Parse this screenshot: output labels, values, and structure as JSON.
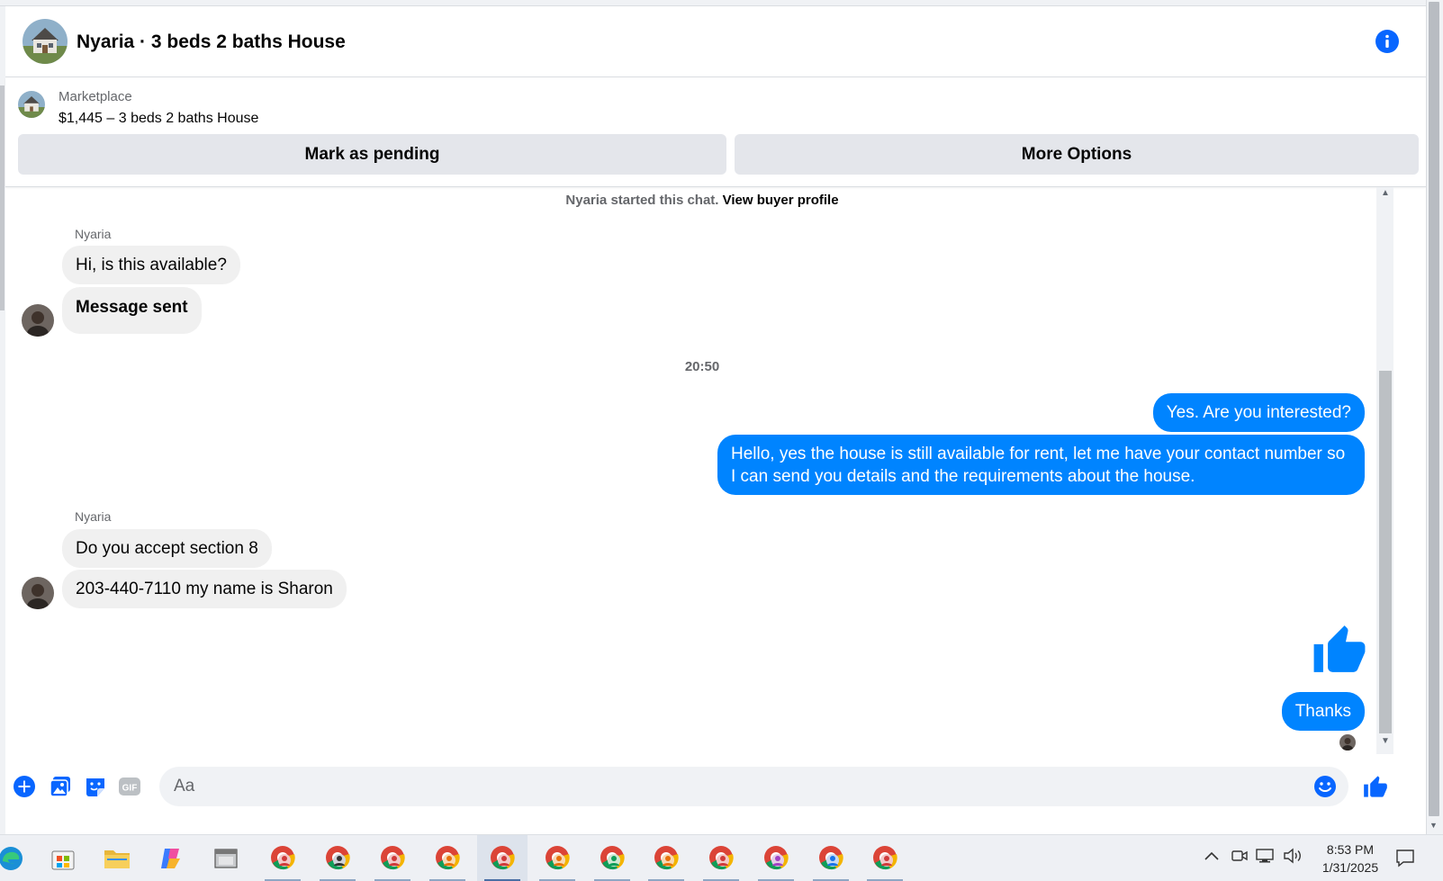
{
  "header": {
    "title": "Nyaria · 3 beds 2 baths House",
    "info_icon": "info-icon"
  },
  "listing": {
    "source": "Marketplace",
    "price_title": "$1,445 – 3 beds 2 baths House",
    "buttons": {
      "pending": "Mark as pending",
      "more": "More Options"
    }
  },
  "chat": {
    "started_text": "Nyaria started this chat.",
    "view_profile": "View buyer profile",
    "sender_name": "Nyaria",
    "timestamp": "20:50",
    "messages": [
      {
        "from": "buyer",
        "text": "Hi, is this available?"
      },
      {
        "from": "buyer",
        "text": "Message sent"
      },
      {
        "from": "seller",
        "text": "Yes. Are you interested?"
      },
      {
        "from": "seller",
        "text": "Hello, yes the house is still available for rent, let me have your contact number so I can send you details and the requirements about the house."
      },
      {
        "from": "buyer",
        "text": "Do you accept section 8"
      },
      {
        "from": "buyer",
        "text": "203-440-7110 my name is Sharon"
      },
      {
        "from": "seller",
        "text": "Thanks"
      }
    ]
  },
  "composer": {
    "placeholder": "Aa",
    "value": "",
    "gif_label": "GIF"
  },
  "taskbar": {
    "time": "8:53 PM",
    "date": "1/31/2025"
  },
  "colors": {
    "accent": "#0866ff",
    "outgoing_bubble": "#0084ff",
    "incoming_bubble": "#f0f0f0",
    "button_bg": "#e4e6eb"
  }
}
